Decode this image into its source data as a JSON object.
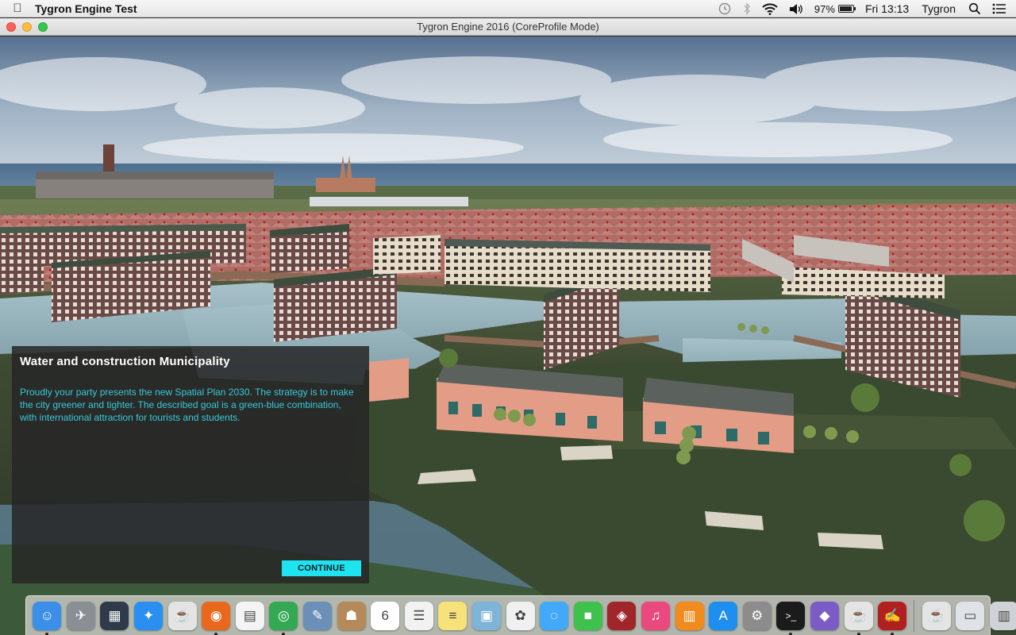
{
  "menubar": {
    "apple_icon": "apple-icon",
    "app_name": "Tygron Engine Test",
    "battery_percent": "97%",
    "battery_level": 0.97,
    "clock": "Fri 13:13",
    "user": "Tygron",
    "status_icons": [
      "time-machine-icon",
      "bluetooth-icon",
      "wifi-icon",
      "volume-icon",
      "battery-icon",
      "search-icon",
      "notification-center-icon"
    ]
  },
  "window": {
    "title": "Tygron Engine 2016 (CoreProfile Mode)"
  },
  "dialog": {
    "title": "Water and construction Municipality",
    "body": "Proudly your party presents the new Spatial Plan 2030. The strategy is to make the city greener and tighter. The described goal is a green-blue combination, with international attraction for tourists and students.",
    "continue_label": "CONTINUE"
  },
  "dock": {
    "items": [
      {
        "name": "finder",
        "icon": "finder-icon",
        "color": "#3b8fe8",
        "glyph": "☺",
        "running": true
      },
      {
        "name": "launchpad",
        "icon": "launchpad-icon",
        "color": "#8a8f96",
        "glyph": "✈",
        "running": false
      },
      {
        "name": "mission-control",
        "icon": "mission-control-icon",
        "color": "#2f3b4a",
        "glyph": "▦",
        "running": false
      },
      {
        "name": "safari",
        "icon": "safari-icon",
        "color": "#2a8ff0",
        "glyph": "✦",
        "running": false
      },
      {
        "name": "coffee-app",
        "icon": "coffee-icon",
        "color": "#e4e4e4",
        "glyph": "☕",
        "running": false
      },
      {
        "name": "firefox",
        "icon": "firefox-icon",
        "color": "#e8681e",
        "glyph": "◉",
        "running": true
      },
      {
        "name": "app-grid",
        "icon": "grid-icon",
        "color": "#f4f4f4",
        "glyph": "▤",
        "running": false
      },
      {
        "name": "chrome",
        "icon": "chrome-icon",
        "color": "#34a853",
        "glyph": "◎",
        "running": true
      },
      {
        "name": "preview",
        "icon": "preview-icon",
        "color": "#6c8fb8",
        "glyph": "✎",
        "running": false
      },
      {
        "name": "contacts",
        "icon": "contacts-icon",
        "color": "#b58a5a",
        "glyph": "☗",
        "running": false
      },
      {
        "name": "calendar",
        "icon": "calendar-icon",
        "color": "#ffffff",
        "glyph": "6",
        "running": false
      },
      {
        "name": "reminders",
        "icon": "reminders-icon",
        "color": "#f2f2f2",
        "glyph": "☰",
        "running": false
      },
      {
        "name": "notes",
        "icon": "notes-icon",
        "color": "#f7e27a",
        "glyph": "≡",
        "running": false
      },
      {
        "name": "photo-viewer",
        "icon": "photo-viewer-icon",
        "color": "#7fb3d8",
        "glyph": "▣",
        "running": false
      },
      {
        "name": "photos",
        "icon": "photos-icon",
        "color": "#f0f0f0",
        "glyph": "✿",
        "running": false
      },
      {
        "name": "messages",
        "icon": "messages-icon",
        "color": "#41a9f7",
        "glyph": "◌",
        "running": false
      },
      {
        "name": "facetime",
        "icon": "facetime-icon",
        "color": "#3fc14e",
        "glyph": "■",
        "running": false
      },
      {
        "name": "photo-booth",
        "icon": "photo-booth-icon",
        "color": "#a0262b",
        "glyph": "◈",
        "running": false
      },
      {
        "name": "itunes",
        "icon": "itunes-icon",
        "color": "#e9497e",
        "glyph": "♫",
        "running": false
      },
      {
        "name": "ibooks",
        "icon": "ibooks-icon",
        "color": "#f28b1d",
        "glyph": "▥",
        "running": false
      },
      {
        "name": "app-store",
        "icon": "app-store-icon",
        "color": "#1e8ef0",
        "glyph": "A",
        "running": false
      },
      {
        "name": "system-preferences",
        "icon": "gear-icon",
        "color": "#8c8c8c",
        "glyph": "⚙",
        "running": false
      },
      {
        "name": "terminal",
        "icon": "terminal-icon",
        "color": "#1b1b1b",
        "glyph": ">_",
        "running": true
      },
      {
        "name": "github",
        "icon": "github-icon",
        "color": "#7b5cc7",
        "glyph": "◆",
        "running": false
      },
      {
        "name": "coffee-app-2",
        "icon": "coffee-icon",
        "color": "#e4e4e4",
        "glyph": "☕",
        "running": true
      },
      {
        "name": "script-editor",
        "icon": "script-icon",
        "color": "#b02020",
        "glyph": "✍",
        "running": true
      }
    ],
    "right_items": [
      {
        "name": "coffee-app-3",
        "icon": "coffee-icon",
        "color": "#e4e4e4",
        "glyph": "☕"
      },
      {
        "name": "downloads-stack",
        "icon": "downloads-icon",
        "color": "#dfe3e8",
        "glyph": "▭"
      },
      {
        "name": "trash",
        "icon": "trash-icon",
        "color": "#cfd2d6",
        "glyph": "▥"
      }
    ]
  }
}
